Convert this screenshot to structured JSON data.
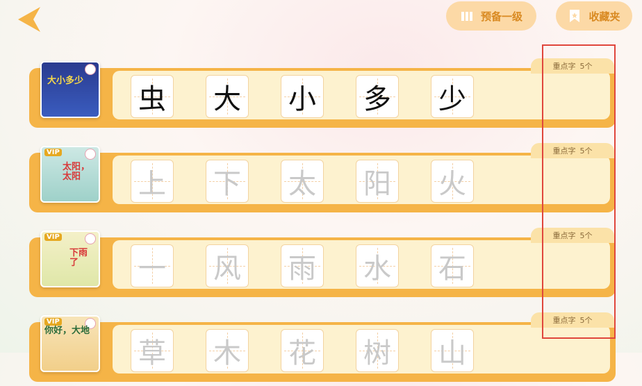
{
  "header": {
    "prep_label": "预备一级",
    "fav_label": "收藏夹"
  },
  "colors": {
    "accent": "#f5b447",
    "highlight": "#e0463c"
  },
  "lessons": [
    {
      "cover_title": "大小多少",
      "vip": "",
      "tab_label": "重点字",
      "tab_count": "5个",
      "chars": [
        "虫",
        "大",
        "小",
        "多",
        "少"
      ],
      "unlocked": true
    },
    {
      "cover_title": "太阳，太阳",
      "vip": "VIP",
      "tab_label": "重点字",
      "tab_count": "5个",
      "chars": [
        "上",
        "下",
        "太",
        "阳",
        "火"
      ],
      "unlocked": false
    },
    {
      "cover_title": "下雨了",
      "vip": "VIP",
      "tab_label": "重点字",
      "tab_count": "5个",
      "chars": [
        "一",
        "风",
        "雨",
        "水",
        "石"
      ],
      "unlocked": false
    },
    {
      "cover_title": "你好，大地",
      "vip": "VIP",
      "tab_label": "重点字",
      "tab_count": "5个",
      "chars": [
        "草",
        "木",
        "花",
        "树",
        "山"
      ],
      "unlocked": false
    }
  ]
}
